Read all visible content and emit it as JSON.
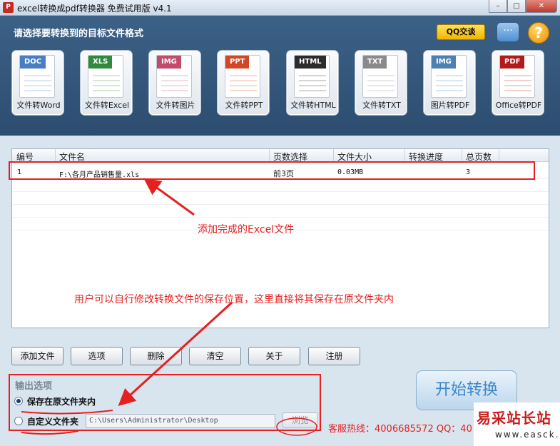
{
  "window": {
    "title": "excel转换成pdf转换器 免费试用版 v4.1",
    "buttons": {
      "minimize": "–",
      "maximize": "□",
      "close": "✕"
    }
  },
  "header": {
    "title": "请选择要转换到的目标文件格式",
    "qq_label": "QQ交谈",
    "help_glyph": "?"
  },
  "tiles": [
    {
      "tag": "DOC",
      "label": "文件转Word",
      "color": "#4a7ec2"
    },
    {
      "tag": "XLS",
      "label": "文件转Excel",
      "color": "#2f8a3e"
    },
    {
      "tag": "IMG",
      "label": "文件转图片",
      "color": "#c24a6a"
    },
    {
      "tag": "PPT",
      "label": "文件转PPT",
      "color": "#d24726"
    },
    {
      "tag": "HTML",
      "label": "文件转HTML",
      "color": "#2b2b2b"
    },
    {
      "tag": "TXT",
      "label": "文件转TXT",
      "color": "#8a8a8a"
    },
    {
      "tag": "IMG",
      "label": "图片转PDF",
      "color": "#4d7fb3"
    },
    {
      "tag": "PDF",
      "label": "Office转PDF",
      "color": "#b31b1b"
    }
  ],
  "table": {
    "columns": [
      "编号",
      "文件名",
      "页数选择",
      "文件大小",
      "转换进度",
      "总页数"
    ],
    "rows": [
      {
        "id": "1",
        "filename": "F:\\各月产品销售量.xls",
        "pages": "前3页",
        "size": "0.03MB",
        "progress": "",
        "total": "3"
      }
    ]
  },
  "annotations": {
    "added": "添加完成的Excel文件",
    "save_hint": "用户可以自行修改转换文件的保存位置，这里直接将其保存在原文件夹内"
  },
  "buttons": [
    "添加文件",
    "选项",
    "删除",
    "清空",
    "关于",
    "注册"
  ],
  "output": {
    "title": "输出选项",
    "option_original": "保存在原文件夹内",
    "option_custom": "自定义文件夹",
    "selected": "option_original",
    "path": "C:\\Users\\Administrator\\Desktop",
    "browse": "浏览"
  },
  "start_label": "开始转换",
  "hotline": "客服热线：4006685572 QQ：40",
  "watermark": {
    "top": "易采站长站",
    "bottom": "www.easck.com"
  },
  "colors": {
    "accent_red": "#e52020",
    "header_blue": "#34587d",
    "panel": "#d8e4ee"
  }
}
